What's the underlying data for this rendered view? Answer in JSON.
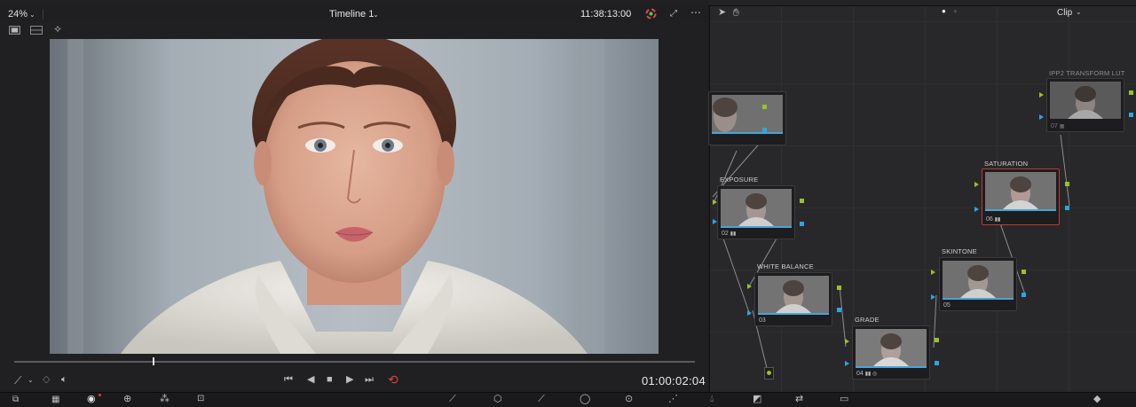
{
  "viewer": {
    "zoom": "24%",
    "timeline_name": "Timeline 1",
    "source_timecode": "11:38:13:00",
    "record_timecode": "01:00:02:04"
  },
  "node_panel": {
    "mode": "Clip",
    "nodes": [
      {
        "id": "node-01",
        "label": "",
        "number": ""
      },
      {
        "id": "node-02",
        "label": "EXPOSURE",
        "number": "02"
      },
      {
        "id": "node-03",
        "label": "WHITE BALANCE",
        "number": "03"
      },
      {
        "id": "node-04",
        "label": "GRADE",
        "number": "04"
      },
      {
        "id": "node-05",
        "label": "SKINTONE",
        "number": "05"
      },
      {
        "id": "node-06",
        "label": "SATURATION",
        "number": "06"
      },
      {
        "id": "node-07",
        "label": "IPP2 TRANSFORM LUT",
        "number": "07"
      }
    ]
  },
  "colors": {
    "accent_red": "#c0393a",
    "output_green": "#9ac226",
    "input_blue": "#29a8df"
  },
  "icons": [
    "chevron-down-icon",
    "more-icon",
    "pointer-icon",
    "hand-icon",
    "wand-icon",
    "eyedropper-icon",
    "volume-icon",
    "skip-back-icon",
    "step-back-icon",
    "stop-icon",
    "play-icon",
    "skip-forward-icon",
    "loop-icon"
  ]
}
